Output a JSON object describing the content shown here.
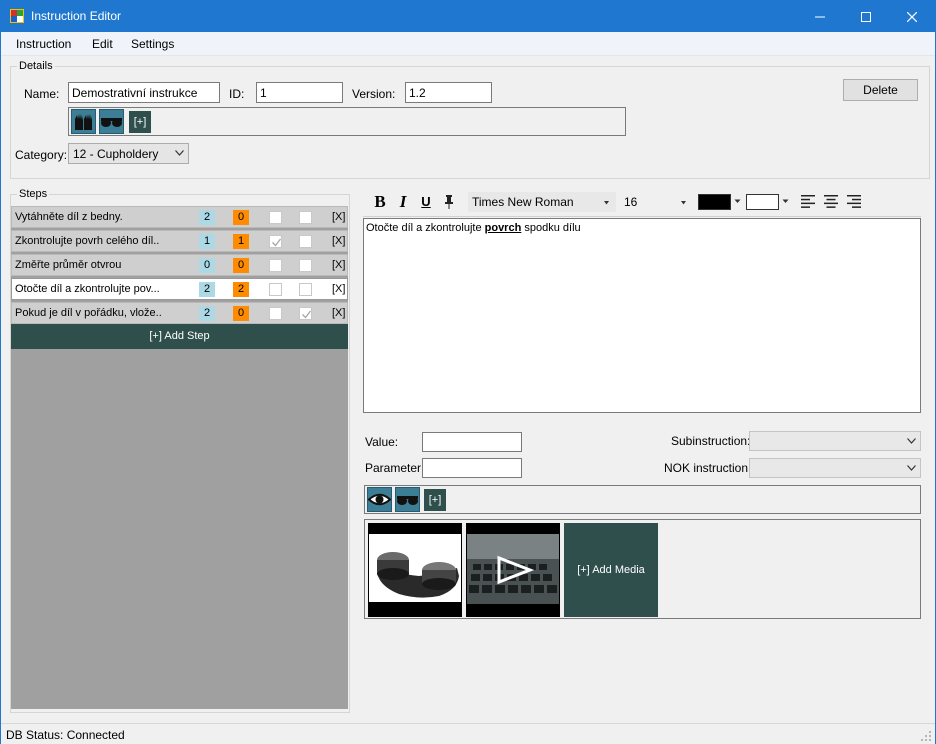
{
  "window": {
    "title": "Instruction Editor"
  },
  "menu": {
    "items": [
      "Instruction",
      "Edit",
      "Settings"
    ]
  },
  "details": {
    "legend": "Details",
    "name_label": "Name:",
    "name_value": "Demostrativní instrukce",
    "id_label": "ID:",
    "id_value": "1",
    "version_label": "Version:",
    "version_value": "1.2",
    "delete_label": "Delete",
    "add_tag_label": "[+]",
    "category_label": "Category:",
    "category_value": "12 - Cupholdery",
    "tag_icons": [
      "gloves-icon",
      "safety-glasses-icon"
    ]
  },
  "steps": {
    "legend": "Steps",
    "delete_label": "[X]",
    "add_label": "[+] Add Step",
    "items": [
      {
        "text": "Vytáhněte díl z bedny.",
        "count_a": "2",
        "count_b": "0",
        "check1": false,
        "check2": false,
        "selected": false
      },
      {
        "text": "Zkontrolujte povrh celého díl..",
        "count_a": "1",
        "count_b": "1",
        "check1": true,
        "check2": false,
        "selected": false
      },
      {
        "text": "Změřte průměr otvrou",
        "count_a": "0",
        "count_b": "0",
        "check1": false,
        "check2": false,
        "selected": false
      },
      {
        "text": "Otočte díl a zkontrolujte pov...",
        "count_a": "2",
        "count_b": "2",
        "check1": false,
        "check2": false,
        "selected": true
      },
      {
        "text": "Pokud je díl v pořádku, vlože..",
        "count_a": "2",
        "count_b": "0",
        "check1": false,
        "check2": true,
        "selected": false
      }
    ]
  },
  "editor": {
    "bold": "B",
    "italic": "I",
    "underline": "U",
    "font_name": "Times New Roman",
    "font_size": "16",
    "fore_color": "#000000",
    "back_color": "#ffffff",
    "text_before": "Otočte díl a zkontrolujte ",
    "text_bold": "povrch",
    "text_after": " spodku dílu"
  },
  "fields": {
    "value_label": "Value:",
    "value_value": "",
    "parameter_label": "Parameter:",
    "parameter_value": "",
    "subinstruction_label": "Subinstruction:",
    "subinstruction_value": "",
    "nok_label": "NOK instruction:",
    "nok_value": ""
  },
  "step_tags": {
    "icons": [
      "eye-icon",
      "safety-glasses-icon"
    ],
    "add_label": "[+]"
  },
  "media": {
    "add_label": "[+] Add Media"
  },
  "status": {
    "text": "DB Status: Connected"
  },
  "colors": {
    "titlebar": "#1f77d0",
    "accent_dark": "#2f4f4d",
    "badge_blue": "#add8e6",
    "badge_orange": "#ff8c00"
  }
}
